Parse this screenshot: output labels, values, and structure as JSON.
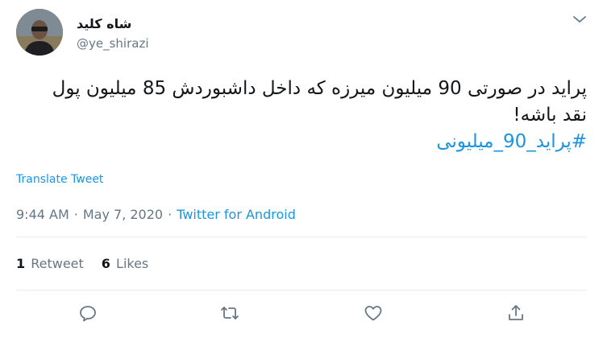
{
  "user": {
    "display_name": "شاه کلید",
    "handle": "@ye_shirazi"
  },
  "tweet": {
    "text": "پراید در صورتی 90 میلیون میرزه که داخل داشبوردش 85 میلیون پول نقد باشه!",
    "hashtag": "#پراید_90_میلیونی"
  },
  "translate_label": "Translate Tweet",
  "meta": {
    "time": "9:44 AM",
    "separator_1": "·",
    "date": "May 7, 2020",
    "separator_2": "·",
    "source": "Twitter for Android"
  },
  "stats": {
    "retweets_count": "1",
    "retweets_label": "Retweet",
    "likes_count": "6",
    "likes_label": "Likes"
  },
  "icons": {
    "reply": "reply-icon",
    "retweet": "retweet-icon",
    "like": "heart-icon",
    "share": "share-icon",
    "menu": "chevron-down-icon"
  },
  "colors": {
    "link": "#1b95e0",
    "muted": "#657786",
    "text": "#14171a",
    "divider": "#e6ecf0"
  }
}
